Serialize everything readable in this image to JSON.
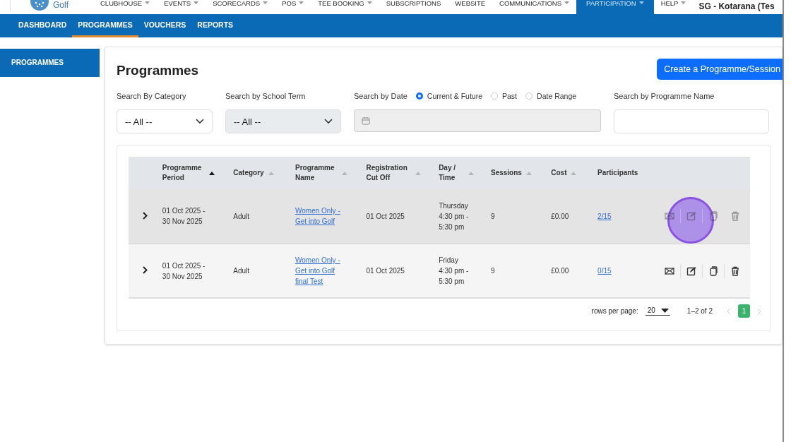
{
  "brand": {
    "name": "Golf"
  },
  "top_nav": [
    {
      "label": "CLUBHOUSE",
      "has_menu": true,
      "selected": false
    },
    {
      "label": "EVENTS",
      "has_menu": true,
      "selected": false
    },
    {
      "label": "SCORECARDS",
      "has_menu": true,
      "selected": false
    },
    {
      "label": "POS",
      "has_menu": true,
      "selected": false
    },
    {
      "label": "TEE BOOKING",
      "has_menu": true,
      "selected": false
    },
    {
      "label": "SUBSCRIPTIONS",
      "has_menu": false,
      "selected": false
    },
    {
      "label": "WEBSITE",
      "has_menu": false,
      "selected": false
    },
    {
      "label": "COMMUNICATIONS",
      "has_menu": true,
      "selected": false
    },
    {
      "label": "PARTICIPATION",
      "has_menu": true,
      "selected": true
    },
    {
      "label": "HELP",
      "has_menu": true,
      "selected": false
    }
  ],
  "club_name": "SG - Kotarana (Tes",
  "sub_nav": [
    {
      "label": "DASHBOARD",
      "selected": false
    },
    {
      "label": "PROGRAMMES",
      "selected": true
    },
    {
      "label": "VOUCHERS",
      "selected": false
    },
    {
      "label": "REPORTS",
      "selected": false
    }
  ],
  "sidebar": {
    "items": [
      {
        "label": "PROGRAMMES",
        "selected": true
      }
    ]
  },
  "page": {
    "title": "Programmes",
    "create_button": "Create a Programme/Session"
  },
  "filters": {
    "category": {
      "label": "Search By Category",
      "value": "-- All --",
      "disabled": false
    },
    "school_term": {
      "label": "Search by School Term",
      "value": "-- All --",
      "disabled": true
    },
    "date": {
      "label": "Search by Date",
      "options": [
        {
          "label": "Current & Future",
          "selected": true
        },
        {
          "label": "Past",
          "selected": false
        },
        {
          "label": "Date Range",
          "selected": false
        }
      ]
    },
    "programme_name": {
      "label": "Search by Programme Name"
    }
  },
  "table": {
    "columns": [
      {
        "label": "Programme Period",
        "sortable": true,
        "sorted": true
      },
      {
        "label": "Category",
        "sortable": true,
        "sorted": false
      },
      {
        "label": "Programme Name",
        "sortable": true,
        "sorted": false
      },
      {
        "label": "Registration Cut Off",
        "sortable": true,
        "sorted": false
      },
      {
        "label": "Day / Time",
        "sortable": true,
        "sorted": false
      },
      {
        "label": "Sessions",
        "sortable": true,
        "sorted": false
      },
      {
        "label": "Cost",
        "sortable": true,
        "sorted": false
      },
      {
        "label": "Participants",
        "sortable": false
      }
    ],
    "rows": [
      {
        "highlighted": true,
        "period": "01 Oct 2025 - 30 Nov 2025",
        "category": "Adult",
        "name": "Women Only - Get into Golf",
        "cut_off": "01 Oct 2025",
        "day_time": "Thursday 4:30 pm - 5:30 pm",
        "sessions": "9",
        "cost": "£0.00",
        "participants": "2/15"
      },
      {
        "highlighted": false,
        "period": "01 Oct 2025 - 30 Nov 2025",
        "category": "Adult",
        "name": "Women Only - Get into Golf final Test",
        "cut_off": "01 Oct 2025",
        "day_time": "Friday 4:30 pm - 5:30 pm",
        "sessions": "9",
        "cost": "£0.00",
        "participants": "0/15"
      }
    ]
  },
  "pagination": {
    "rows_label": "rows per page:",
    "rows_per_page": "20",
    "range": "1–2 of 2",
    "pages": [
      {
        "label": "1",
        "selected": true
      }
    ]
  }
}
